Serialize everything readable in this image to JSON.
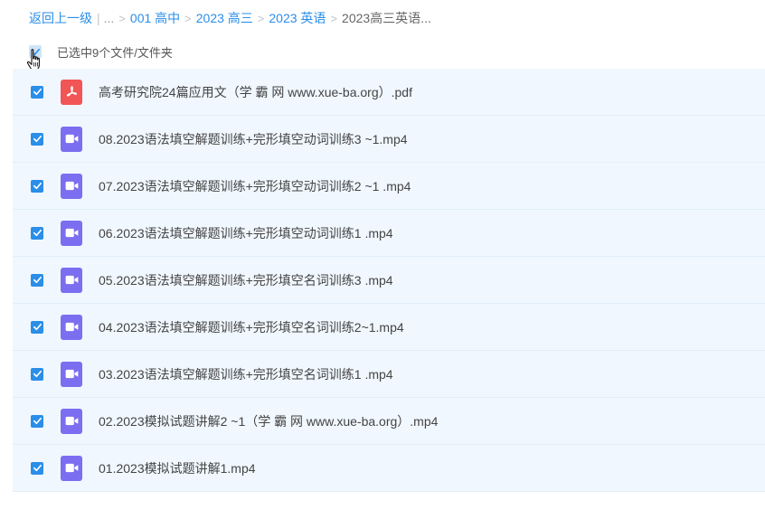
{
  "breadcrumb": {
    "back_label": "返回上一级",
    "ellipsis": "...",
    "items": [
      "001 高中",
      "2023 高三",
      "2023 英语"
    ],
    "current": "2023高三英语..."
  },
  "selection": {
    "label": "已选中9个文件/文件夹"
  },
  "files": [
    {
      "name": "高考研究院24篇应用文（学 霸 网 www.xue-ba.org）.pdf",
      "type": "pdf",
      "icon": "pdf-file-icon"
    },
    {
      "name": "08.2023语法填空解题训练+完形填空动词训练3 ~1.mp4",
      "type": "video",
      "icon": "video-file-icon"
    },
    {
      "name": "07.2023语法填空解题训练+完形填空动词训练2 ~1 .mp4",
      "type": "video",
      "icon": "video-file-icon"
    },
    {
      "name": "06.2023语法填空解题训练+完形填空动词训练1 .mp4",
      "type": "video",
      "icon": "video-file-icon"
    },
    {
      "name": "05.2023语法填空解题训练+完形填空名词训练3 .mp4",
      "type": "video",
      "icon": "video-file-icon"
    },
    {
      "name": "04.2023语法填空解题训练+完形填空名词训练2~1.mp4",
      "type": "video",
      "icon": "video-file-icon"
    },
    {
      "name": "03.2023语法填空解题训练+完形填空名词训练1 .mp4",
      "type": "video",
      "icon": "video-file-icon"
    },
    {
      "name": "02.2023模拟试题讲解2 ~1（学 霸 网 www.xue-ba.org）.mp4",
      "type": "video",
      "icon": "video-file-icon"
    },
    {
      "name": "01.2023模拟试题讲解1.mp4",
      "type": "video",
      "icon": "video-file-icon"
    }
  ],
  "colors": {
    "accent": "#2b8ee8",
    "row_bg": "#f0f7fe",
    "pdf_icon": "#f25555",
    "video_icon": "#7b6ef0"
  }
}
